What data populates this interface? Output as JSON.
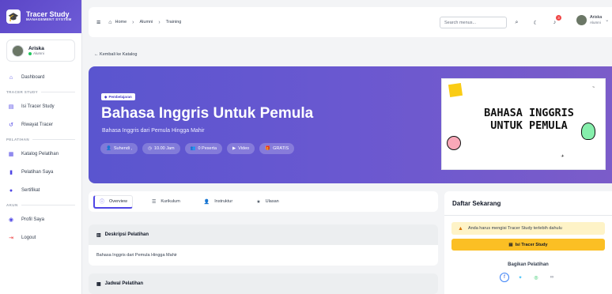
{
  "brand": {
    "title": "Tracer Study",
    "subtitle": "MANAGEMENT SYSTEM"
  },
  "user": {
    "name": "Ariska",
    "role": "Alumni"
  },
  "sidebar": {
    "dashboard": "Dashboard",
    "section_tracer": "TRACER STUDY",
    "isi_tracer": "Isi Tracer Study",
    "riwayat": "Riwayat Tracer",
    "section_pelatihan": "PELATIHAN",
    "katalog": "Katalog Pelatihan",
    "pelatihan_saya": "Pelatihan Saya",
    "sertifikat": "Sertifikat",
    "section_akun": "AKUN",
    "profil": "Profil Saya",
    "logout": "Logout"
  },
  "breadcrumb": {
    "home": "Home",
    "alumni": "Alumni",
    "training": "Training"
  },
  "search": {
    "placeholder": "Search menus..."
  },
  "notifications": {
    "count": "3"
  },
  "back_link": "← Kembali ke Katalog",
  "course": {
    "tag": "Pembelajaran",
    "title": "Bahasa Inggris Untuk Pemula",
    "subtitle": "Bahasa Inggris dari Pemula Hingga Mahir",
    "chips": {
      "instructor": "Suhendi ,",
      "time": "10.00 Jam",
      "participants": "0 Peserta",
      "media": "Video",
      "price": "GRATIS"
    },
    "image_text": "BAHASA INGGRIS UNTUK PEMULA"
  },
  "tabs": {
    "overview": "Overview",
    "kurikulum": "Kurikulum",
    "instruktur": "Instruktur",
    "ulasan": "Ulasan"
  },
  "description": {
    "title": "Deskripsi Pelatihan",
    "body": "Bahasa Inggris dari Pemula Hingga Mahir"
  },
  "schedule": {
    "title": "Jadwal Pelatihan"
  },
  "panel": {
    "title": "Daftar Sekarang",
    "warning": "Anda harus mengisi Tracer Study terlebih dahulu",
    "cta": "Isi Tracer Study",
    "share_title": "Bagikan Pelatihan"
  },
  "colors": {
    "primary": "#5b46c7",
    "hero_start": "#5a55cf",
    "hero_end": "#7b5cc9",
    "accent": "#fbbf24",
    "warning_bg": "#fef3c7"
  }
}
